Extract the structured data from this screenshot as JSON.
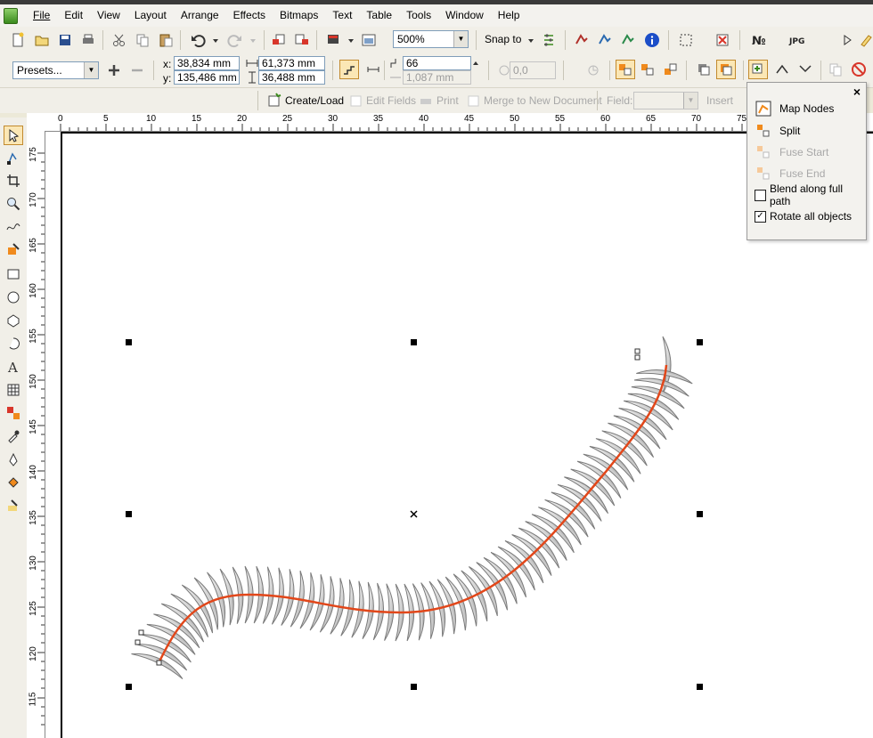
{
  "menu": [
    "File",
    "Edit",
    "View",
    "Layout",
    "Arrange",
    "Effects",
    "Bitmaps",
    "Text",
    "Table",
    "Tools",
    "Window",
    "Help"
  ],
  "toolbar": {
    "zoom": "500%",
    "snap_to": "Snap to"
  },
  "property_bar": {
    "presets": "Presets...",
    "x_label": "x:",
    "y_label": "y:",
    "x_value": "38,834 mm",
    "y_value": "135,486 mm",
    "width_value": "61,373 mm",
    "height_value": "36,488 mm",
    "steps_value": "66",
    "spacing_value": "1,087 mm",
    "rotation_value": "0,0"
  },
  "merge_bar": {
    "create_load": "Create/Load",
    "edit_fields": "Edit Fields",
    "print": "Print",
    "merge": "Merge to New Document",
    "field_label": "Field:",
    "insert": "Insert"
  },
  "ruler_h": [
    "0",
    "5",
    "10",
    "15",
    "20",
    "25",
    "30",
    "35",
    "40",
    "45",
    "50",
    "55",
    "60",
    "65",
    "70",
    "75"
  ],
  "ruler_v": [
    "175",
    "170",
    "165",
    "160",
    "155",
    "150",
    "145",
    "140",
    "135",
    "130",
    "125",
    "120",
    "115"
  ],
  "popup": {
    "close": "×",
    "map_nodes": "Map Nodes",
    "split": "Split",
    "fuse_start": "Fuse Start",
    "fuse_end": "Fuse End",
    "blend_full_path": "Blend along full path",
    "blend_full_path_checked": false,
    "rotate_all": "Rotate all objects",
    "rotate_all_checked": true
  },
  "colors": {
    "path": "#e2471a",
    "blend_fill": "#d9d9d9",
    "accent_orange": "#f08a1c"
  }
}
